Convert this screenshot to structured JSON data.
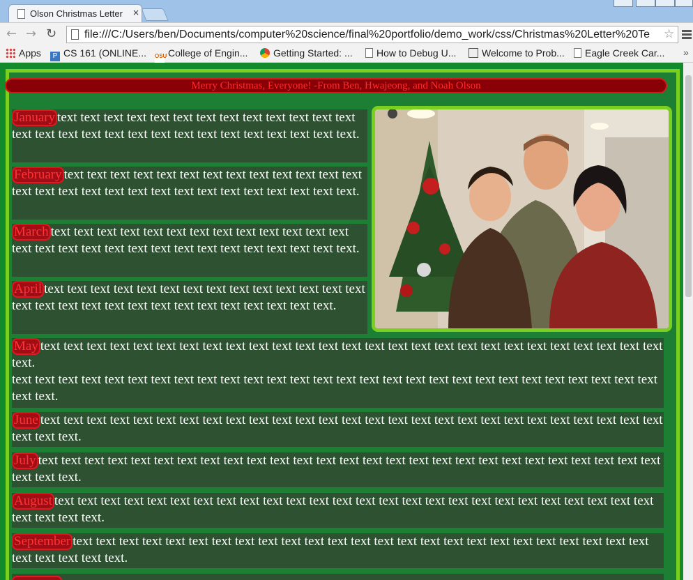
{
  "browser": {
    "tab_title": "Olson Christmas Letter",
    "tab_close": "×",
    "url": "file:///C:/Users/ben/Documents/computer%20science/final%20portfolio/demo_work/css/Christmas%20Letter%20Te",
    "nav": {
      "back": "←",
      "forward": "→",
      "reload": "↻"
    },
    "star": "☆"
  },
  "bookmarks": [
    {
      "label": "Apps",
      "icon": "apps-icon"
    },
    {
      "label": "CS 161 (ONLINE...",
      "icon": "cs-icon"
    },
    {
      "label": "College of Engin...",
      "icon": "osu-icon"
    },
    {
      "label": "Getting Started: ...",
      "icon": "chrome-icon"
    },
    {
      "label": "How to Debug U...",
      "icon": "page-icon"
    },
    {
      "label": "Welcome to Prob...",
      "icon": "prob-icon"
    },
    {
      "label": "Eagle Creek Car...",
      "icon": "page-icon"
    }
  ],
  "bookmarks_overflow": "»",
  "banner": "Merry Christmas, Everyone! -From Ben, Hwajeong, and Noah Olson",
  "months": [
    {
      "label": "January",
      "text": "text text text text text text text text text text text text text text text text text text text text text text text text text text text text."
    },
    {
      "label": "February",
      "text": "text text text text text text text text text text text text text text text text text text text text text text text text text text text text."
    },
    {
      "label": "March",
      "text": "text text text text text text text text text text text text text text text text text text text text text text text text text text text text."
    },
    {
      "label": "April",
      "text": "text text text text text text text text text text text text text text text text text text text text text text text text text text text text."
    },
    {
      "label": "May",
      "text": "text text text text text text text text text text text text text text text text text text text text text text text text text text text text.",
      "text2": "text text text text text text text text text text text text text text text text text text text text text text text text text text text text text text."
    },
    {
      "label": "June",
      "text": "text text text text text text text text text text text text text text text text text text text text text text text text text text text text text text."
    },
    {
      "label": "July",
      "text": "text text text text text text text text text text text text text text text text text text text text text text text text text text text text text text."
    },
    {
      "label": "August",
      "text": "text text text text text text text text text text text text text text text text text text text text text text text text text text text text text text."
    },
    {
      "label": "September",
      "text": "text text text text text text text text text text text text text text text text text text text text text text text text text text text text text text."
    }
  ]
}
